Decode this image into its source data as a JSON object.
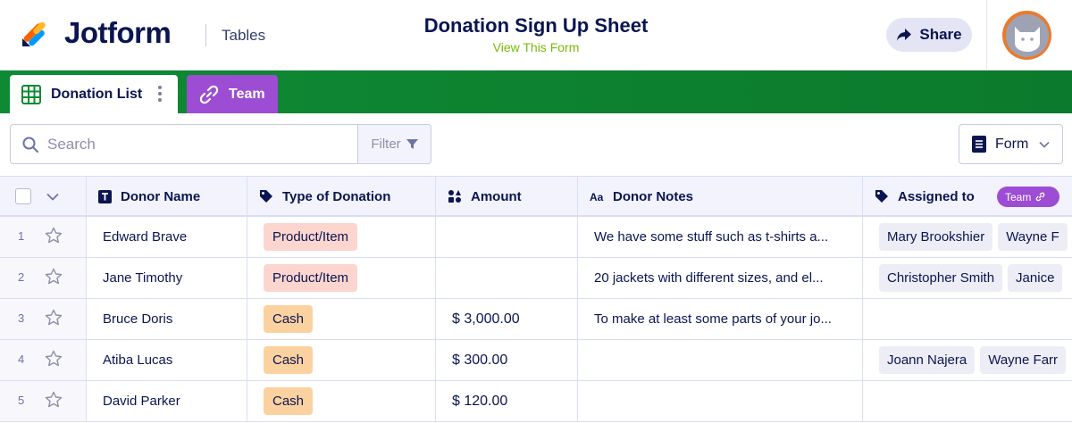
{
  "header": {
    "logo_text": "Jotform",
    "section_link": "Tables",
    "form_title": "Donation Sign Up Sheet",
    "view_form_label": "View This Form",
    "share_label": "Share",
    "logo_colors": [
      "#ff6100",
      "#0099ff",
      "#ffb629",
      "#0a1551"
    ]
  },
  "tabs": [
    {
      "label": "Donation List",
      "icon": "table-grid-icon",
      "active": true
    },
    {
      "label": "Team",
      "icon": "link-icon",
      "active": false,
      "color": "#9c4dd3"
    }
  ],
  "toolbar": {
    "search_placeholder": "Search",
    "filter_label": "Filter",
    "form_label": "Form"
  },
  "columns": [
    {
      "label": "Donor Name",
      "icon": "text-field-icon"
    },
    {
      "label": "Type of Donation",
      "icon": "tag-icon"
    },
    {
      "label": "Amount",
      "icon": "shapes-icon"
    },
    {
      "label": "Donor Notes",
      "icon": "text-aa-icon"
    },
    {
      "label": "Assigned to",
      "icon": "tag-icon",
      "badge": "Team"
    }
  ],
  "rows": [
    {
      "num": "1",
      "name": "Edward Brave",
      "type": "Product/Item",
      "amount": "",
      "notes": "We have some stuff such as t-shirts a...",
      "assigned": [
        "Mary Brookshier",
        "Wayne F"
      ]
    },
    {
      "num": "2",
      "name": "Jane Timothy",
      "type": "Product/Item",
      "amount": "",
      "notes": "20 jackets with different sizes, and el...",
      "assigned": [
        "Christopher Smith",
        "Janice"
      ]
    },
    {
      "num": "3",
      "name": "Bruce Doris",
      "type": "Cash",
      "amount": "$ 3,000.00",
      "notes": "To make at least some parts of your jo...",
      "assigned": []
    },
    {
      "num": "4",
      "name": "Atiba Lucas",
      "type": "Cash",
      "amount": "$ 300.00",
      "notes": "",
      "assigned": [
        "Joann Najera",
        "Wayne Farr"
      ]
    },
    {
      "num": "5",
      "name": "David Parker",
      "type": "Cash",
      "amount": "$ 120.00",
      "notes": "",
      "assigned": []
    }
  ],
  "colors": {
    "tabbar_green": "#0e8a34",
    "team_purple": "#9c4dd3",
    "product_pill": "#fcd5cf",
    "cash_pill": "#fcd1a0",
    "view_form_green": "#78bb07"
  }
}
